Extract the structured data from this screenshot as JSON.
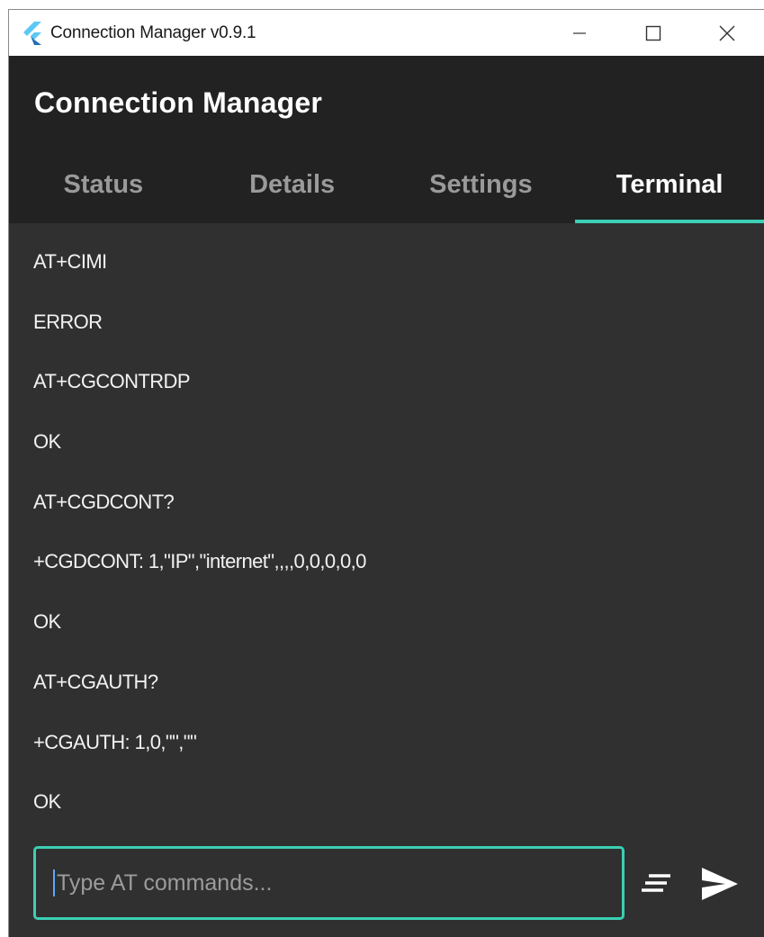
{
  "window": {
    "title": "Connection Manager v0.9.1",
    "controls": {
      "minimize": "minimize-icon",
      "maximize": "maximize-icon",
      "close": "close-icon"
    }
  },
  "header": {
    "title": "Connection Manager"
  },
  "tabs": [
    {
      "label": "Status",
      "active": false
    },
    {
      "label": "Details",
      "active": false
    },
    {
      "label": "Settings",
      "active": false
    },
    {
      "label": "Terminal",
      "active": true
    }
  ],
  "terminal": {
    "lines": [
      "AT+CIMI",
      "ERROR",
      "AT+CGCONTRDP",
      "OK",
      "AT+CGDCONT?",
      "+CGDCONT: 1,\"IP\",\"internet\",,,,0,0,0,0,0",
      "OK",
      "AT+CGAUTH?",
      "+CGAUTH: 1,0,\"\",\"\"",
      "OK"
    ]
  },
  "input": {
    "value": "",
    "placeholder": "Type AT commands..."
  },
  "actions": {
    "clear_icon": "clear-all-icon",
    "send_icon": "send-icon"
  },
  "colors": {
    "accent": "#3ccfb4",
    "header_bg": "#222222",
    "body_bg": "#303030",
    "tab_inactive": "#9a9a9a",
    "text": "#f2f2f2"
  }
}
